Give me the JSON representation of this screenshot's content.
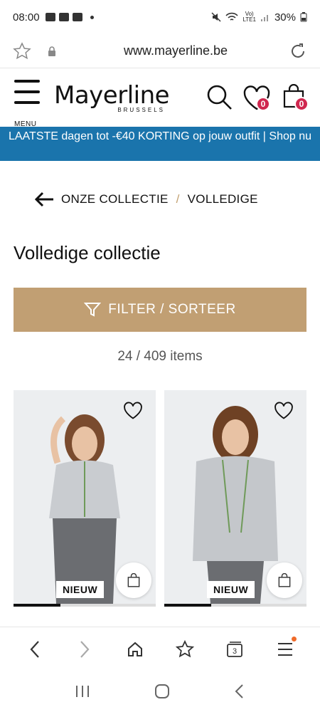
{
  "status_bar": {
    "time": "08:00",
    "battery": "30%",
    "network": "Vo)\nLTE1"
  },
  "browser": {
    "url": "www.mayerline.be",
    "tab_count": "3"
  },
  "header": {
    "menu_label": "MENU",
    "logo_name": "Mayerline",
    "logo_sub": "BRUSSELS",
    "wishlist_count": "0",
    "cart_count": "0"
  },
  "promo": {
    "text": "LAATSTE dagen tot -€40 KORTING op jouw outfit | Shop nu"
  },
  "breadcrumb": {
    "items": [
      "ONZE COLLECTIE",
      "VOLLEDIGE"
    ],
    "separator": "/"
  },
  "page": {
    "title": "Volledige collectie",
    "filter_label": "FILTER / SORTEER",
    "count": "24 / 409 items"
  },
  "products": [
    {
      "tag": "NIEUW",
      "image_progress": 0.33
    },
    {
      "tag": "NIEUW",
      "image_progress": 0.33
    }
  ],
  "colors": {
    "promo": "#1a74ac",
    "filter": "#c19f73",
    "badge": "#d0274f",
    "accent": "#c2a070"
  }
}
